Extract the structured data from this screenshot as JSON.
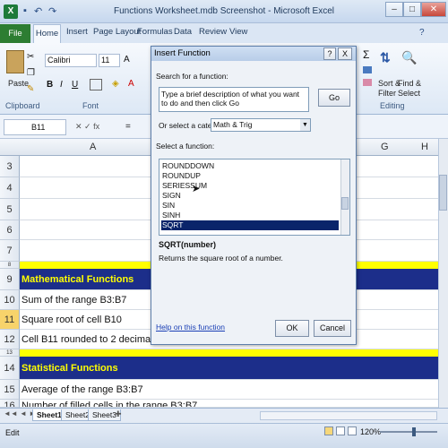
{
  "window": {
    "title": "Functions Worksheet.mdb Screenshot - Microsoft Excel",
    "app_icon": "X"
  },
  "quick_access": [
    "save-icon",
    "undo-icon",
    "redo-icon"
  ],
  "tabs": [
    "File",
    "Home",
    "Insert",
    "Page Layout",
    "Formulas",
    "Data",
    "Review",
    "View"
  ],
  "ribbon": {
    "paste_label": "Paste",
    "font_name": "Calibri",
    "font_size": "11",
    "groups": {
      "clipboard": "Clipboard",
      "font": "Font",
      "editing": "Editing"
    },
    "sort_filter": "Sort &\nFilter",
    "find_select": "Find &\nSelect",
    "sum_glyph": "Σ"
  },
  "formula_bar": {
    "name_box": "B11",
    "fx": "=",
    "icons": "✕ ✓ fx"
  },
  "columns": {
    "a": "A",
    "g": "G",
    "h": "H"
  },
  "rows": [
    {
      "num": "3",
      "text": ""
    },
    {
      "num": "4",
      "text": ""
    },
    {
      "num": "5",
      "text": ""
    },
    {
      "num": "6",
      "text": ""
    },
    {
      "num": "7",
      "text": ""
    },
    {
      "num": "8",
      "text": ""
    },
    {
      "num": "9",
      "text": "Mathematical Functions"
    },
    {
      "num": "10",
      "text": "Sum of the range B3:B7"
    },
    {
      "num": "11",
      "text": "Square root of cell B10"
    },
    {
      "num": "12",
      "text": "Cell B11 rounded to 2 decimal places"
    },
    {
      "num": "13",
      "text": ""
    },
    {
      "num": "14",
      "text": "Statistical Functions"
    },
    {
      "num": "15",
      "text": "Average of the range B3:B7"
    },
    {
      "num": "16",
      "text": "Number of filled cells in the range B3:B7"
    }
  ],
  "sheets": [
    "Sheet1",
    "Sheet2",
    "Sheet3"
  ],
  "status": {
    "mode": "Edit",
    "zoom": "120%"
  },
  "dialog": {
    "title": "Insert Function",
    "search_label": "Search for a function:",
    "search_value": "Type a brief description of what you want to do and then click Go",
    "go_label": "Go",
    "category_label": "Or select a category:",
    "category_value": "Math & Trig",
    "select_label": "Select a function:",
    "functions": [
      "ROUNDDOWN",
      "ROUNDUP",
      "SERIESSUM",
      "SIGN",
      "SIN",
      "SINH",
      "SQRT"
    ],
    "selected": "SQRT",
    "signature": "SQRT(number)",
    "description": "Returns the square root of a number.",
    "help_link": "Help on this function",
    "ok_label": "OK",
    "cancel_label": "Cancel",
    "help_btn": "?",
    "close_btn": "X"
  },
  "colors": {
    "header_band": "#1c2e8a",
    "header_text": "#ffff00",
    "separator": "#ffff00",
    "selection": "#0a246a"
  }
}
